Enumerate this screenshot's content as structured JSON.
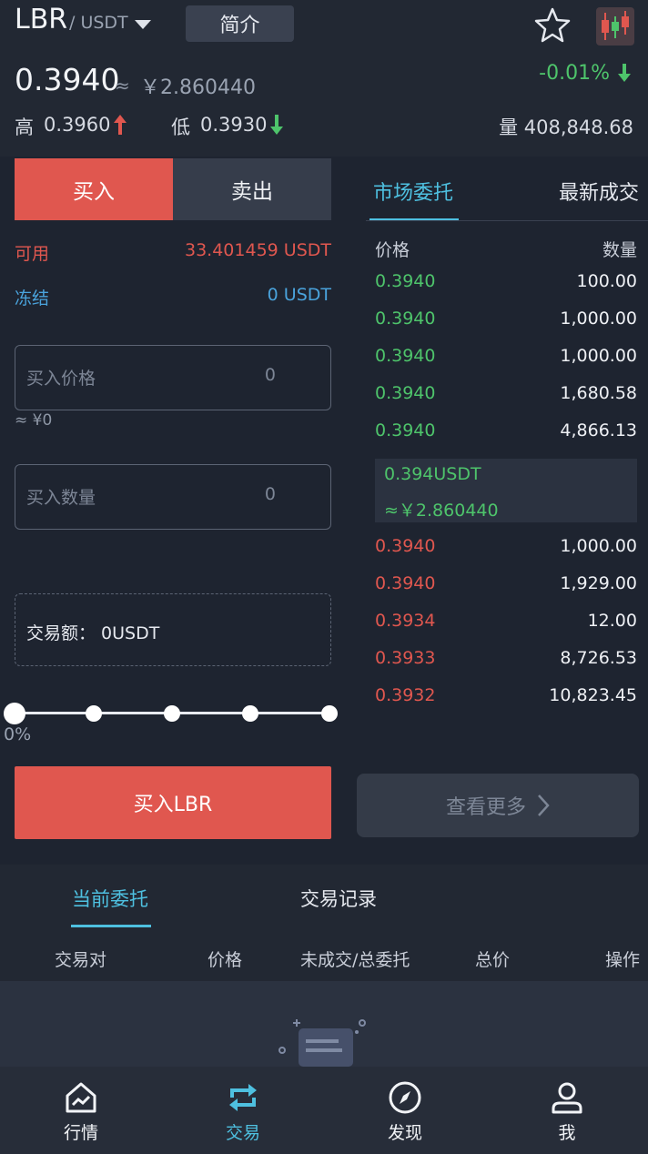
{
  "header": {
    "base": "LBR",
    "quote": "/ USDT",
    "intro_label": "简介",
    "last_price": "0.3940",
    "approx": "≈",
    "cny_price": "￥2.860440",
    "change_pct": "-0.01%",
    "high_label": "高",
    "high_value": "0.3960",
    "low_label": "低",
    "low_value": "0.3930",
    "volume": "量 408,848.68",
    "icons": [
      "star-icon",
      "kline-icon",
      "arrow-down-icon",
      "arrow-up-icon"
    ],
    "colors": {
      "up": "#4ec46b",
      "down": "#e0574f",
      "accent": "#4ec0e0"
    }
  },
  "form": {
    "buy_tab": "买入",
    "sell_tab": "卖出",
    "available_label": "可用",
    "available_value": "33.401459 USDT",
    "frozen_label": "冻结",
    "frozen_value": "0 USDT",
    "price_label": "买入价格",
    "price_value": "0",
    "price_approx": "≈ ¥0",
    "qty_label": "买入数量",
    "qty_value": "0",
    "amount_text": "交易额： 0USDT",
    "slider_pct": "0%",
    "slider_level": 0,
    "submit_label": "买入LBR"
  },
  "book": {
    "tab_active": "市场委托",
    "tab_other": "最新成交",
    "head_price": "价格",
    "head_qty": "数量",
    "asks": [
      {
        "price": "0.3940",
        "qty": "100.00"
      },
      {
        "price": "0.3940",
        "qty": "1,000.00"
      },
      {
        "price": "0.3940",
        "qty": "1,000.00"
      },
      {
        "price": "0.3940",
        "qty": "1,680.58"
      },
      {
        "price": "0.3940",
        "qty": "4,866.13"
      }
    ],
    "mid_price": "0.394USDT",
    "mid_cny": "≈￥2.860440",
    "bids": [
      {
        "price": "0.3940",
        "qty": "1,000.00"
      },
      {
        "price": "0.3940",
        "qty": "1,929.00"
      },
      {
        "price": "0.3934",
        "qty": "12.00"
      },
      {
        "price": "0.3933",
        "qty": "8,726.53"
      },
      {
        "price": "0.3932",
        "qty": "10,823.45"
      }
    ],
    "more_label": "查看更多"
  },
  "orders": {
    "tab_active": "当前委托",
    "tab_other": "交易记录",
    "columns": [
      "交易对",
      "价格",
      "未成交/总委托",
      "总价",
      "操作"
    ]
  },
  "nav": [
    {
      "label": "行情",
      "icon": "market-icon"
    },
    {
      "label": "交易",
      "icon": "trade-icon"
    },
    {
      "label": "发现",
      "icon": "compass-icon"
    },
    {
      "label": "我",
      "icon": "user-icon"
    }
  ]
}
